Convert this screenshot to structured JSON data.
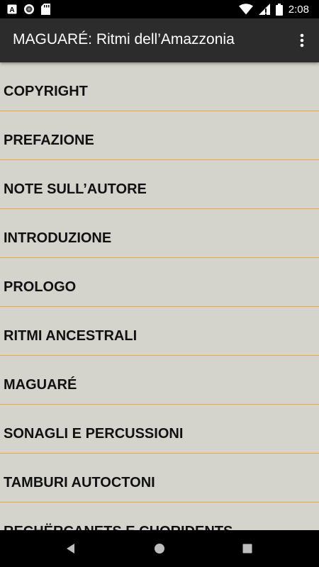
{
  "status_bar": {
    "time": "2:08",
    "icons": [
      "a-notification-icon",
      "circle-notification-icon",
      "sd-card-icon",
      "wifi-icon",
      "signal-icon",
      "battery-icon"
    ]
  },
  "app_bar": {
    "title": "MAGUARÉ: Ritmi dell’Amazzonia",
    "menu_icon": "more-vert-icon"
  },
  "chapters": [
    {
      "label": "COPYRIGHT"
    },
    {
      "label": "PREFAZIONE"
    },
    {
      "label": "NOTE SULL’AUTORE"
    },
    {
      "label": "INTRODUZIONE"
    },
    {
      "label": "PROLOGO"
    },
    {
      "label": "RITMI ANCESTRALI"
    },
    {
      "label": "MAGUARÉ"
    },
    {
      "label": "SONAGLI E PERCUSSIONI"
    },
    {
      "label": "TAMBURI AUTOCTONI"
    },
    {
      "label": "RECHËRCANETS E CHORIDENTS"
    }
  ],
  "colors": {
    "list_background": "#d4d4cd",
    "divider": "#f6a43a",
    "app_bar": "#2c2c2c",
    "status_bar": "#000000"
  },
  "nav_bar": {
    "icons": [
      "back-icon",
      "home-icon",
      "recents-icon"
    ]
  }
}
